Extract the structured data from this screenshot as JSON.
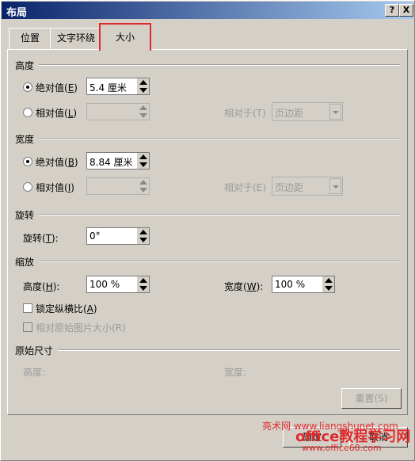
{
  "window": {
    "title": "布局",
    "help": "?",
    "close": "X"
  },
  "tabs": [
    "位置",
    "文字环绕",
    "大小"
  ],
  "height": {
    "section": "高度",
    "absolute": {
      "label": "绝对值(",
      "key": "E",
      "end": ")",
      "value": "5.4 厘米"
    },
    "relative": {
      "label": "相对值(",
      "key": "L",
      "end": ")",
      "relative_to": "相对于(T)",
      "combo": "页边距"
    }
  },
  "width": {
    "section": "宽度",
    "absolute": {
      "label": "绝对值(",
      "key": "B",
      "end": ")",
      "value": "8.84 厘米"
    },
    "relative": {
      "label": "相对值(",
      "key": "I",
      "end": ")",
      "relative_to": "相对于(E)",
      "combo": "页边距"
    }
  },
  "rotate": {
    "section": "旋转",
    "label": "旋转(",
    "key": "T",
    "end": "):",
    "value": "0°"
  },
  "scale": {
    "section": "缩放",
    "height_label": "高度(",
    "height_key": "H",
    "height_end": "):",
    "height_value": "100 %",
    "width_label": "宽度(",
    "width_key": "W",
    "width_end": "):",
    "width_value": "100 %",
    "lock": {
      "label": "锁定纵横比(",
      "key": "A",
      "end": ")"
    },
    "relative_original": "相对原始图片大小(R)"
  },
  "original": {
    "section": "原始尺寸",
    "height": "高度:",
    "width": "宽度:"
  },
  "buttons": {
    "reset": "重置(S)",
    "ok": "确定",
    "cancel": "取消"
  },
  "watermark": {
    "line1": "亮术网 www.liangshunet.com",
    "line2": "office教程学习网",
    "line3": "www.office68.com"
  },
  "colors": {
    "titlebar": "#0a246a",
    "active_tab_border": "#e0292a"
  }
}
